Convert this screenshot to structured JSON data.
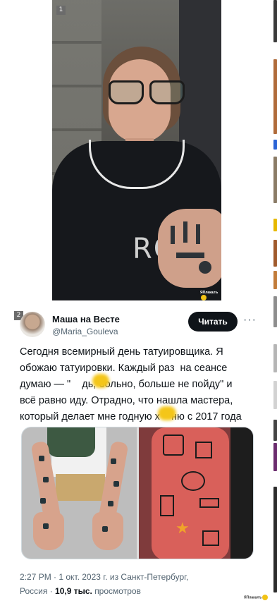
{
  "post": {
    "photo1": {
      "index": "1",
      "print_text": "RO"
    },
    "photo2_badge": "2",
    "watermark": "ЯПлакалъ",
    "tweet": {
      "author_name": "Маша на Весте",
      "author_handle": "@Maria_Gouleva",
      "follow_label": "Читать",
      "more_icon": "···",
      "text": "Сегодня всемирный день татуировщика. Я\nобожаю татуировки. Каждый раз  на сеансе\nдумаю — \"    дь, больно, больше не пойду\" и\nвсё равно иду. Отрадно, что нашла мастера,\nкоторый делает мне годную х    ню с 2017 года",
      "timestamp": "2:27 PM · 1 окт. 2023 г. из Санкт-Петербург,",
      "location_line2": "Россия · ",
      "views_count": "10,9 тыс.",
      "views_label": "просмотров"
    },
    "censor_color": "#f4c619"
  }
}
